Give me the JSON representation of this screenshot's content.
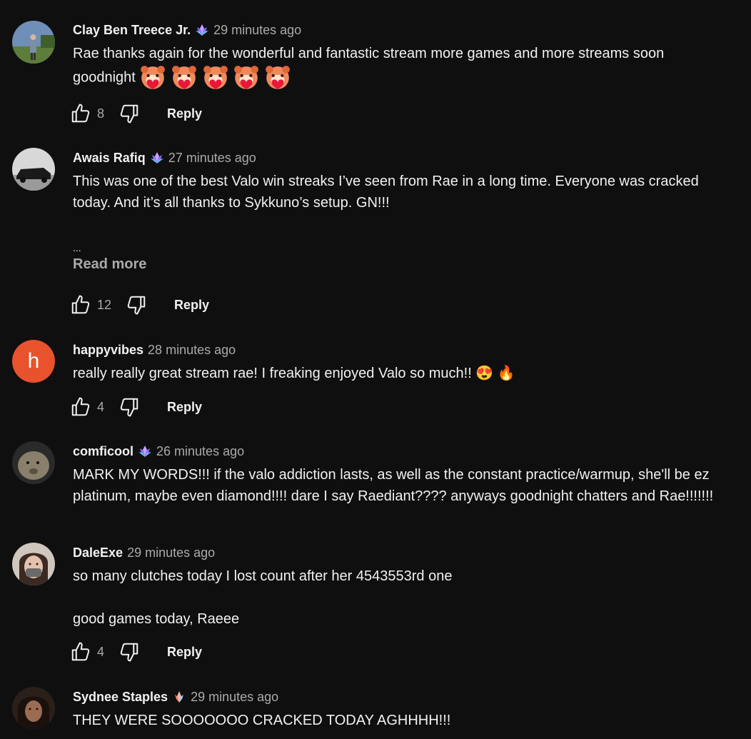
{
  "comments": [
    {
      "author": "Clay Ben Treece Jr.",
      "time": "29 minutes ago",
      "text": "Rae thanks again for the wonderful and fantastic stream more games and more streams soon goodnight",
      "likes": "8",
      "reply": "Reply",
      "badge": "member-badge",
      "emojis": [
        "bear-heart-emoji",
        "bear-heart-emoji",
        "bear-heart-emoji",
        "bear-heart-emoji",
        "bear-heart-emoji"
      ]
    },
    {
      "author": "Awais Rafiq",
      "time": "27 minutes ago",
      "text": "This was one of the best Valo win streaks I’ve seen from Rae in a long time. Everyone was cracked today. And it’s all thanks to Sykkuno’s setup. GN!!!",
      "ellipsis": "...",
      "read_more": "Read more",
      "likes": "12",
      "reply": "Reply",
      "badge": "member-badge"
    },
    {
      "author": "happyvibes",
      "time": "28 minutes ago",
      "text": "really really great stream rae! I freaking enjoyed Valo so much!!",
      "emoji_text": "😍 🔥",
      "likes": "4",
      "reply": "Reply",
      "avatar_letter": "h",
      "avatar_color": "#e8532d"
    },
    {
      "author": "comficool",
      "time": "26 minutes ago",
      "text": "MARK MY WORDS!!! if the valo addiction lasts, as well as the constant practice/warmup, she'll be ez platinum, maybe even diamond!!!! dare I say Raediant???? anyways goodnight chatters and Rae!!!!!!!",
      "badge": "member-badge"
    },
    {
      "author": "DaleExe",
      "time": "29 minutes ago",
      "text_line1": "so many clutches today I lost count after her 4543553rd one",
      "text_line2": "good games today, Raeee",
      "likes": "4",
      "reply": "Reply"
    },
    {
      "author": "Sydnee Staples",
      "time": "29 minutes ago",
      "text": "THEY WERE SOOOOOOO CRACKED TODAY AGHHHH!!!",
      "badge": "member-badge-small"
    }
  ],
  "colors": {
    "background": "#0f0f0f",
    "text": "#f1f1f1",
    "secondary": "#aaaaaa",
    "badge": "#9b6cf0"
  }
}
